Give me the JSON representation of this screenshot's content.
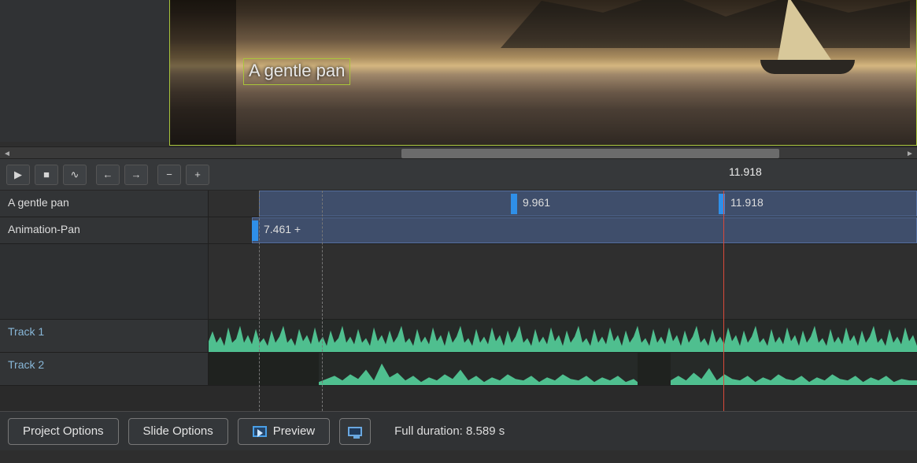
{
  "preview": {
    "caption": "A gentle pan"
  },
  "toolbar": {
    "play_icon": "▶",
    "stop_icon": "■",
    "wave_icon": "∿",
    "left_icon": "←",
    "right_icon": "→",
    "minus_icon": "−",
    "plus_icon": "+",
    "cursor_time": "11.918"
  },
  "tracks": {
    "caption": {
      "label": "A gentle pan",
      "kf1_time": "9.961",
      "kf2_time": "11.918"
    },
    "animation": {
      "label": "Animation-Pan",
      "kf_time": "7.461 +"
    },
    "audio1": {
      "label": "Track 1"
    },
    "audio2": {
      "label": "Track 2"
    }
  },
  "footer": {
    "project_options": "Project Options",
    "slide_options": "Slide Options",
    "preview": "Preview",
    "full_duration": "Full duration: 8.589 s"
  }
}
